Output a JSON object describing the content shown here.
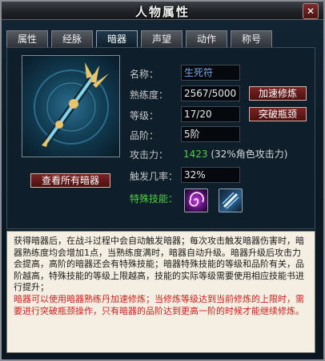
{
  "window": {
    "title": "人物属性",
    "close_label": "✕"
  },
  "tabs": [
    {
      "label": "属性"
    },
    {
      "label": "经脉"
    },
    {
      "label": "暗器",
      "active": true
    },
    {
      "label": "声望"
    },
    {
      "label": "动作"
    },
    {
      "label": "称号"
    }
  ],
  "weapon": {
    "name_label": "名称：",
    "name_value": "生死符",
    "proficiency_label": "熟练度：",
    "proficiency_value": "2567/5000",
    "level_label": "等级：",
    "level_value": "17/20",
    "grade_label": "品阶：",
    "grade_value": "5阶",
    "attack_label": "攻击力：",
    "attack_value": "1423",
    "attack_note": " (32%角色攻击力)",
    "trigger_label": "触发几率：",
    "trigger_value": "32%",
    "skill_label": "特殊技能："
  },
  "buttons": {
    "speed_train": "加速修炼",
    "breakthrough": "突破瓶颈",
    "view_all": "查看所有暗器"
  },
  "description": {
    "black": "获得暗器后，在战斗过程中会自动触发暗器；每次攻击触发暗器伤害时，暗器熟练度均会增加1点，当熟练度满时，暗器自动升级。暗器升级后攻击力会提高，高阶的暗器还会有特殊技能；暗器特殊技能的等级和品阶有关，品阶越高，特殊技能的等级上限越高，技能的实际等级需要使用相应技能书进行提升；",
    "red": "暗器可以使用暗器熟练丹加速修炼；当修炼等级达到当前修炼的上限时，需要进行突破瓶颈操作，只有暗器的品阶达到更高一阶的时候才能继续修炼。"
  },
  "colors": {
    "accent_red": "#7b2424",
    "attack_green": "#4ad23e",
    "name_blue": "#6fa6e6"
  }
}
